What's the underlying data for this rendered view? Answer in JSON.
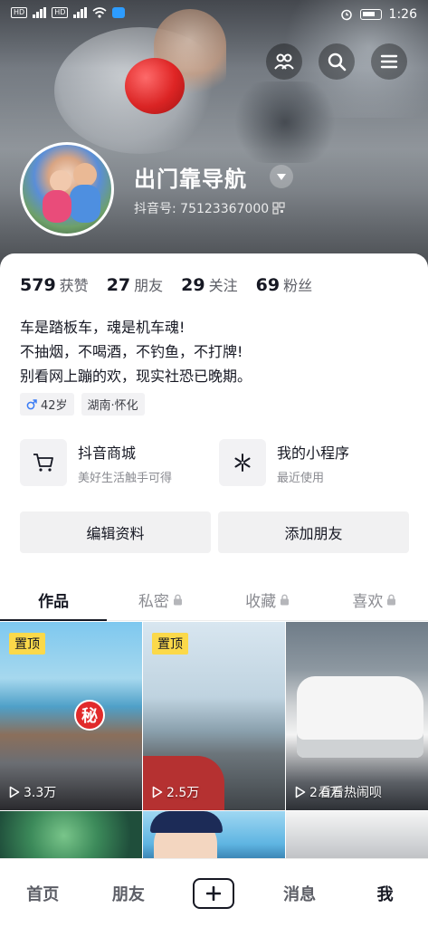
{
  "status_bar": {
    "time": "1:26"
  },
  "profile": {
    "nickname": "出门靠导航",
    "douyin_id": "抖音号: 75123367000",
    "stats": [
      {
        "num": "579",
        "label": "获赞"
      },
      {
        "num": "27",
        "label": "朋友"
      },
      {
        "num": "29",
        "label": "关注"
      },
      {
        "num": "69",
        "label": "粉丝"
      }
    ],
    "bio": [
      "车是踏板车，魂是机车魂!",
      "不抽烟，不喝酒，不钓鱼，不打牌!",
      "别看网上蹦的欢，现实社恐已晚期。"
    ],
    "tags": {
      "age": "42岁",
      "location": "湖南·怀化"
    }
  },
  "services": [
    {
      "title": "抖音商城",
      "subtitle": "美好生活触手可得",
      "icon": "cart-icon"
    },
    {
      "title": "我的小程序",
      "subtitle": "最近使用",
      "icon": "mini-program-icon"
    }
  ],
  "actions": {
    "edit": "编辑资料",
    "add_friend": "添加朋友"
  },
  "tabs": [
    {
      "label": "作品",
      "locked": false
    },
    {
      "label": "私密",
      "locked": true
    },
    {
      "label": "收藏",
      "locked": true
    },
    {
      "label": "喜欢",
      "locked": true
    }
  ],
  "videos": [
    {
      "pinned": "置顶",
      "views": "3.3万",
      "sign": "秘"
    },
    {
      "pinned": "置顶",
      "views": "2.5万"
    },
    {
      "views": "2.0万",
      "cover_text": "看看热闹呗"
    }
  ],
  "bottom_nav": {
    "home": "首页",
    "friends": "朋友",
    "messages": "消息",
    "me": "我"
  },
  "colors": {
    "pin_badge": "#fbd94a",
    "text_primary": "#161823",
    "text_secondary": "#8a8b91"
  }
}
